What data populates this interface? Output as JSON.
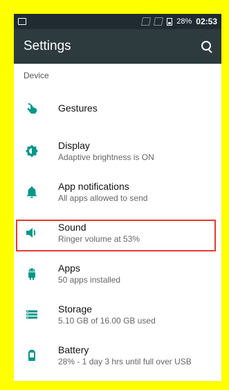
{
  "status": {
    "battery": "28%",
    "time": "02:53"
  },
  "appbar": {
    "title": "Settings"
  },
  "section": {
    "device": "Device"
  },
  "items": [
    {
      "title": "Gestures",
      "subtitle": ""
    },
    {
      "title": "Display",
      "subtitle": "Adaptive brightness is ON"
    },
    {
      "title": "App notifications",
      "subtitle": "All apps allowed to send"
    },
    {
      "title": "Sound",
      "subtitle": "Ringer volume at 53%"
    },
    {
      "title": "Apps",
      "subtitle": "50 apps installed"
    },
    {
      "title": "Storage",
      "subtitle": "5.10 GB of 16.00 GB used"
    },
    {
      "title": "Battery",
      "subtitle": "28% - 1 day 3 hrs until full over USB"
    }
  ],
  "colors": {
    "accent": "#009688",
    "appbar": "#2d3a3e",
    "statusbar": "#1f2b30",
    "highlight": "#e53935",
    "frame": "#ffff00"
  }
}
